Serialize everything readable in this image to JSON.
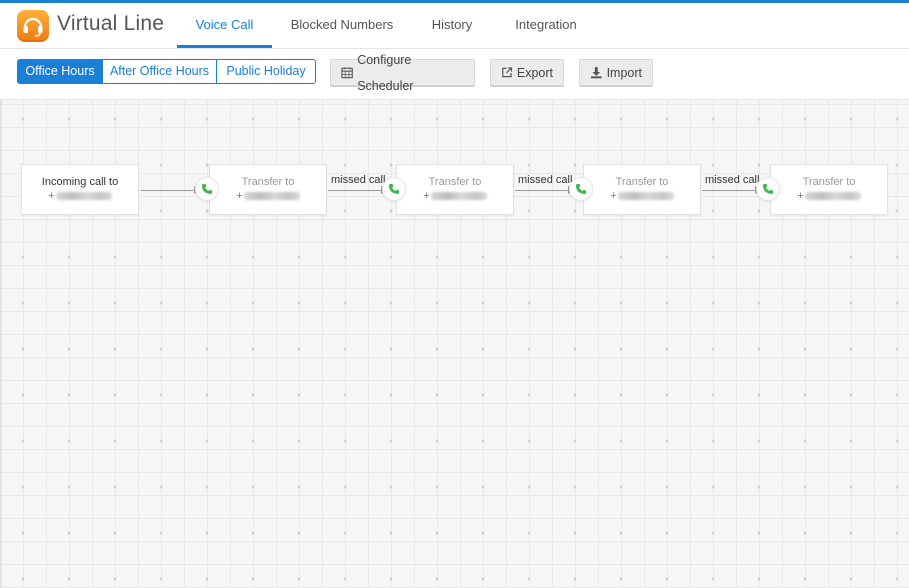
{
  "app": {
    "title": "Virtual Line",
    "logo_icon": "headset-icon",
    "brand_color": "#f58a1f"
  },
  "tabs": [
    {
      "label": "Voice Call",
      "active": true
    },
    {
      "label": "Blocked Numbers",
      "active": false
    },
    {
      "label": "History",
      "active": false
    },
    {
      "label": "Integration",
      "active": false
    }
  ],
  "schedule_segments": [
    {
      "label": "Office Hours",
      "active": true
    },
    {
      "label": "After Office Hours",
      "active": false
    },
    {
      "label": "Public Holiday",
      "active": false
    }
  ],
  "toolbar": {
    "configure_label": "Configure Scheduler",
    "configure_icon": "calendar-icon",
    "export_label": "Export",
    "export_icon": "external-link-icon",
    "import_label": "Import",
    "import_icon": "download-icon"
  },
  "flow": {
    "nodes": [
      {
        "title": "Incoming call to",
        "number_prefix": "+"
      },
      {
        "title": "Transfer to",
        "number_prefix": "+"
      },
      {
        "title": "Transfer to",
        "number_prefix": "+"
      },
      {
        "title": "Transfer to",
        "number_prefix": "+"
      },
      {
        "title": "Transfer to",
        "number_prefix": "+"
      }
    ],
    "edges": [
      {
        "label": ""
      },
      {
        "label": "missed call"
      },
      {
        "label": "missed call"
      },
      {
        "label": "missed call"
      }
    ],
    "step_icon": "phone-icon",
    "step_icon_color": "#3cb84a"
  },
  "colors": {
    "accent": "#1b7fd6"
  }
}
